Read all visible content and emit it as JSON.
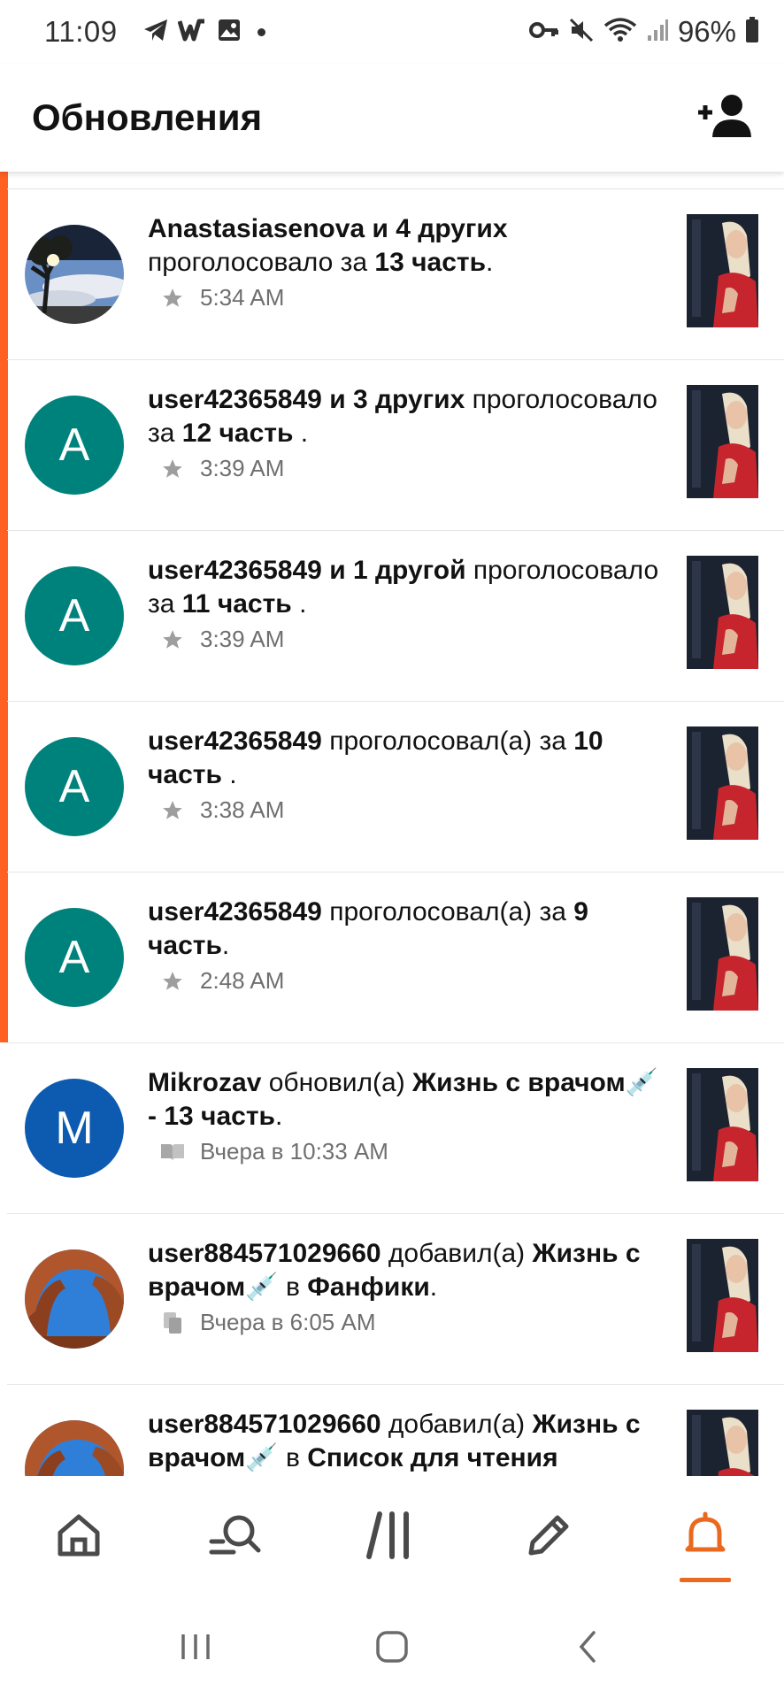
{
  "status_bar": {
    "time": "11:09",
    "battery": "96%"
  },
  "app_bar": {
    "title": "Обновления",
    "add_friend_icon": "add-person-icon"
  },
  "colors": {
    "accent": "#ff6122",
    "teal_avatar": "#00827c",
    "blue_avatar": "#0d5bb0",
    "meta_text": "#6f6f6f"
  },
  "notifications": [
    {
      "user": "Anastasiasenova",
      "rest1": " и 4 других",
      "verb": " проголосовало за ",
      "target": "13 часть",
      "tail": ".",
      "time": "5:34 AM",
      "meta_icon": "star-icon",
      "avatar": "photo-tree"
    },
    {
      "user": "user42365849",
      "rest1": " и 3 других",
      "verb": " проголосовало за ",
      "target": "12 часть",
      "tail": " .",
      "time": "3:39 AM",
      "meta_icon": "star-icon",
      "avatar_letter": "A"
    },
    {
      "user": "user42365849",
      "rest1": " и 1 другой",
      "verb": " проголосовало за ",
      "target": "11 часть",
      "tail": " .",
      "time": "3:39 AM",
      "meta_icon": "star-icon",
      "avatar_letter": "A"
    },
    {
      "user": "user42365849",
      "verb": " проголосовал(а) за ",
      "target": "10 часть",
      "tail": " .",
      "time": "3:38 AM",
      "meta_icon": "star-icon",
      "avatar_letter": "A"
    },
    {
      "user": "user42365849",
      "verb": " проголосовал(а) за ",
      "target": "9 часть",
      "tail": ".",
      "time": "2:48 AM",
      "meta_icon": "star-icon",
      "avatar_letter": "A"
    },
    {
      "user": "Mikrozav",
      "verb": " обновил(а) ",
      "target": "Жизнь с врачом💉 - 13 часть",
      "tail": ".",
      "time": "Вчера в 10:33 AM",
      "meta_icon": "book-icon",
      "avatar_letter": "M"
    },
    {
      "user": "user884571029660",
      "verb": " добавил(а) ",
      "target": "Жизнь с врачом💉",
      "mid": " в ",
      "target2": "Фанфики",
      "tail": ".",
      "time": "Вчера в 6:05 AM",
      "meta_icon": "copy-icon",
      "avatar": "photo-arch"
    },
    {
      "user": "user884571029660",
      "verb": " добавил(а) ",
      "target": "Жизнь с врачом💉",
      "mid": " в ",
      "target2": "Список для чтения",
      "tail": "",
      "avatar": "photo-arch"
    }
  ],
  "bottom_nav": [
    {
      "name": "home",
      "icon": "home-icon"
    },
    {
      "name": "search",
      "icon": "search-icon"
    },
    {
      "name": "library",
      "icon": "library-icon"
    },
    {
      "name": "write",
      "icon": "pencil-icon"
    },
    {
      "name": "notifications",
      "icon": "bell-icon",
      "active": true
    }
  ]
}
